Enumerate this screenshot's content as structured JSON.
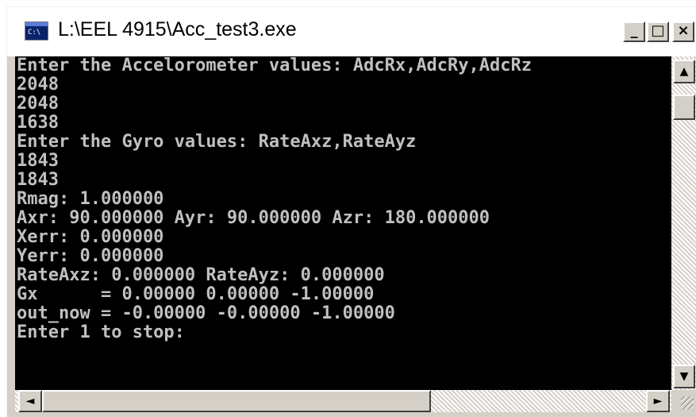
{
  "window": {
    "title": "L:\\EEL 4915\\Acc_test3.exe",
    "icon_text": "C:\\",
    "controls": {
      "minimize": "_",
      "maximize": "□",
      "close": "×"
    }
  },
  "console": {
    "lines": [
      "Enter the Accelorometer values: AdcRx,AdcRy,AdcRz",
      "2048",
      "2048",
      "1638",
      "Enter the Gyro values: RateAxz,RateAyz",
      "1843",
      "1843",
      "Rmag: 1.000000",
      "Axr: 90.000000 Ayr: 90.000000 Azr: 180.000000",
      "Xerr: 0.000000",
      "Yerr: 0.000000",
      "RateAxz: 0.000000 RateAyz: 0.000000",
      "Gx      = 0.00000 0.00000 -1.00000",
      "out_now = -0.00000 -0.00000 -1.00000",
      "Enter 1 to stop:"
    ]
  },
  "scrollbars": {
    "up": "▲",
    "down": "▼",
    "left": "◄",
    "right": "►"
  },
  "colors": {
    "console_bg": "#000000",
    "console_text": "#c0c0c0",
    "window_face": "#d4d0c8"
  }
}
